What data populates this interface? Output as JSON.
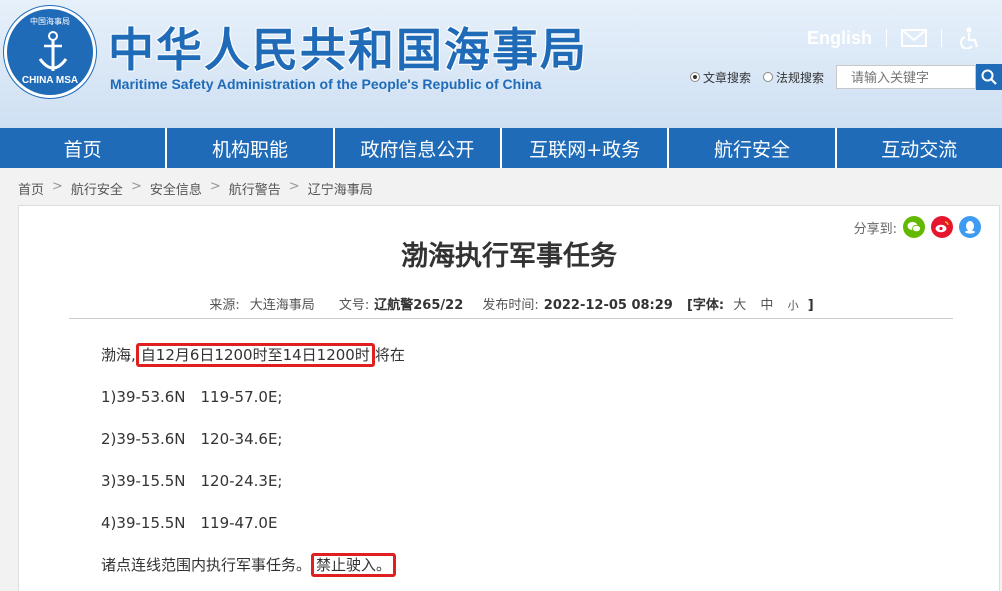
{
  "header": {
    "emblem_top_text": "中国海事局",
    "emblem_bottom_text": "CHINA MSA",
    "title_cn": "中华人民共和国海事局",
    "title_en": "Maritime Safety Administration of the People's Republic of China",
    "lang_link": "English",
    "search": {
      "option_article": "文章搜索",
      "option_law": "法规搜索",
      "placeholder": "请输入关键字"
    }
  },
  "nav": {
    "items": [
      "首页",
      "机构职能",
      "政府信息公开",
      "互联网+政务",
      "航行安全",
      "互动交流"
    ]
  },
  "breadcrumb": [
    "首页",
    "航行安全",
    "安全信息",
    "航行警告",
    "辽宁海事局"
  ],
  "article": {
    "share_label": "分享到:",
    "title": "渤海执行军事任务",
    "meta": {
      "source_label": "来源:",
      "source": "大连海事局",
      "doc_label": "文号:",
      "doc_no": "辽航警265/22",
      "date_label": "发布时间:",
      "date": "2022-12-05 08:29",
      "font_label": "[字体:",
      "font_large": "大",
      "font_medium": "中",
      "font_small": "小",
      "font_close": "]"
    },
    "intro_prefix": "渤海,",
    "intro_highlight": "自12月6日1200时至14日1200时",
    "intro_suffix": "将在",
    "points": [
      "1)39-53.6N　119-57.0E;",
      "2)39-53.6N　120-34.6E;",
      "3)39-15.5N　120-24.3E;",
      "4)39-15.5N　119-47.0E"
    ],
    "closing_prefix": "诸点连线范围内执行军事任务。",
    "closing_highlight": "禁止驶入。"
  },
  "colors": {
    "brand_blue": "#1f6bb8",
    "highlight_red": "#e02020",
    "wechat_green": "#62b900",
    "weibo_red": "#e6162d",
    "qq_blue": "#3d9bf2"
  }
}
